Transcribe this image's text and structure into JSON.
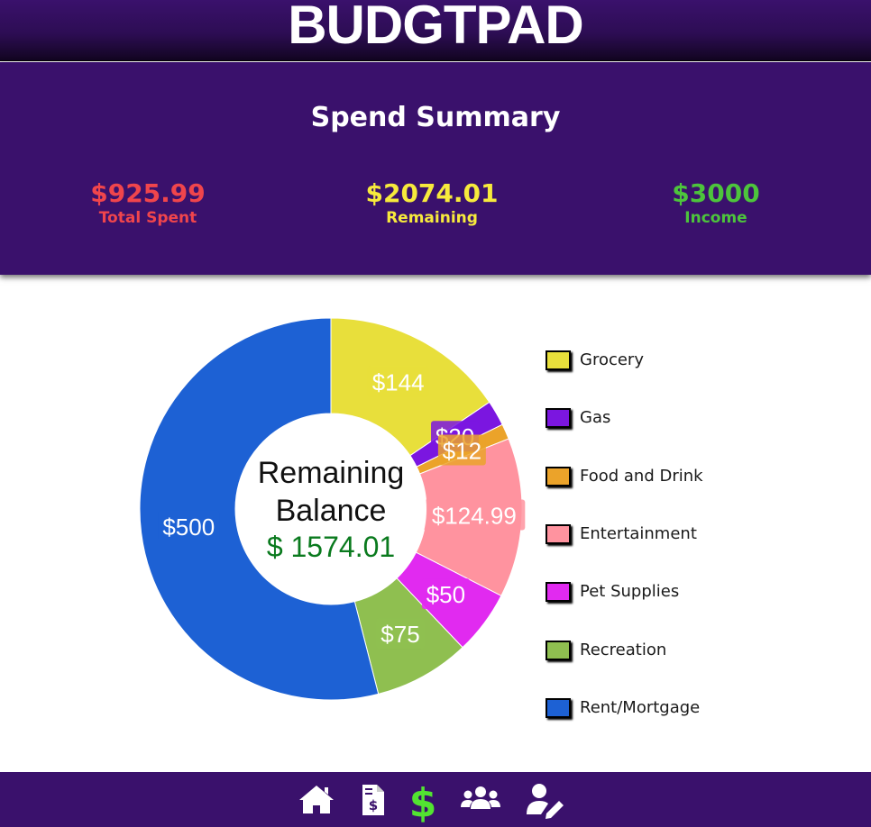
{
  "app": {
    "title": "BUDGTPAD"
  },
  "summary": {
    "title": "Spend Summary",
    "total_spent": {
      "value": "$925.99",
      "label": "Total Spent",
      "color": "#f0454c"
    },
    "remaining": {
      "value": "$2074.01",
      "label": "Remaining",
      "color": "#f7ea3c"
    },
    "income": {
      "value": "$3000",
      "label": "Income",
      "color": "#4dc43c"
    }
  },
  "chart_data": {
    "type": "pie",
    "center_text": {
      "line1": "Remaining",
      "line2": "Balance",
      "value": "$ 1574.01",
      "value_color": "#0a7a1e"
    },
    "categories": [
      "Grocery",
      "Gas",
      "Food and Drink",
      "Entertainment",
      "Pet Supplies",
      "Recreation",
      "Rent/Mortgage"
    ],
    "values": [
      144,
      20,
      12,
      124.99,
      50,
      75,
      500
    ],
    "value_labels": [
      "$144",
      "$20",
      "$12",
      "$124.99",
      "$50",
      "$75",
      "$500"
    ],
    "colors": [
      "#e8df3b",
      "#7b16e0",
      "#eba32a",
      "#ff939f",
      "#e12af0",
      "#8fbf50",
      "#1d61d4"
    ],
    "legend_position": "right"
  },
  "nav": {
    "items": [
      {
        "icon": "home-icon",
        "active": false
      },
      {
        "icon": "invoice-icon",
        "active": false
      },
      {
        "icon": "dollar-icon",
        "active": true
      },
      {
        "icon": "users-icon",
        "active": false
      },
      {
        "icon": "user-edit-icon",
        "active": false
      }
    ],
    "icon_color": "#ffffff",
    "active_color": "#52e331"
  }
}
